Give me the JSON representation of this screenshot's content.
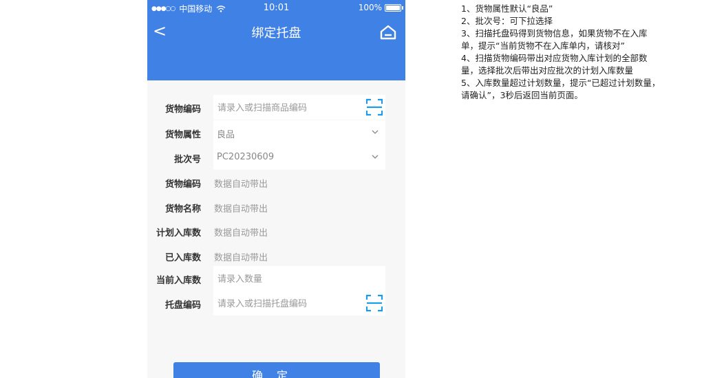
{
  "status_bar": {
    "signal": "●●●○○",
    "carrier": "中国移动",
    "time": "10:01",
    "battery": "100%"
  },
  "nav": {
    "back_label": "<",
    "title": "绑定托盘"
  },
  "form": {
    "goods_code": {
      "label": "货物编码",
      "placeholder": "请录入或扫描商品编码"
    },
    "goods_attr": {
      "label": "货物属性",
      "value": "良品"
    },
    "batch_no": {
      "label": "批次号",
      "value": "PC20230609"
    },
    "goods_code_auto": {
      "label": "货物编码",
      "value": "数据自动带出"
    },
    "goods_name": {
      "label": "货物名称",
      "value": "数据自动带出"
    },
    "planned_qty": {
      "label": "计划入库数",
      "value": "数据自动带出"
    },
    "received_qty": {
      "label": "已入库数",
      "value": "数据自动带出"
    },
    "current_qty": {
      "label": "当前入库数",
      "placeholder": "请录入数量"
    },
    "pallet_code": {
      "label": "托盘编码",
      "placeholder": "请录入或扫描托盘编码"
    }
  },
  "confirm_label": "确定",
  "notes": [
    "1、货物属性默认“良品”",
    "2、批次号：可下拉选择",
    "3、扫描托盘码得到货物信息，如果货物不在入库单，提示“当前货物不在入库单内，请核对”",
    "4、扫描货物编码带出对应货物入库计划的全部数量，选择批次后带出对应批次的计划入库数量",
    "5、入库数量超过计划数量，提示“已超过计划数量，请确认”，3秒后返回当前页面。"
  ],
  "colors": {
    "primary": "#4081e6",
    "scan_icon": "#1e9be8",
    "background": "#f7f7f7"
  },
  "icons": {
    "back": "back-arrow-icon",
    "home": "home-icon",
    "scan": "scan-icon",
    "dropdown": "chevron-down-icon",
    "wifi": "wifi-icon",
    "battery": "battery-icon"
  }
}
